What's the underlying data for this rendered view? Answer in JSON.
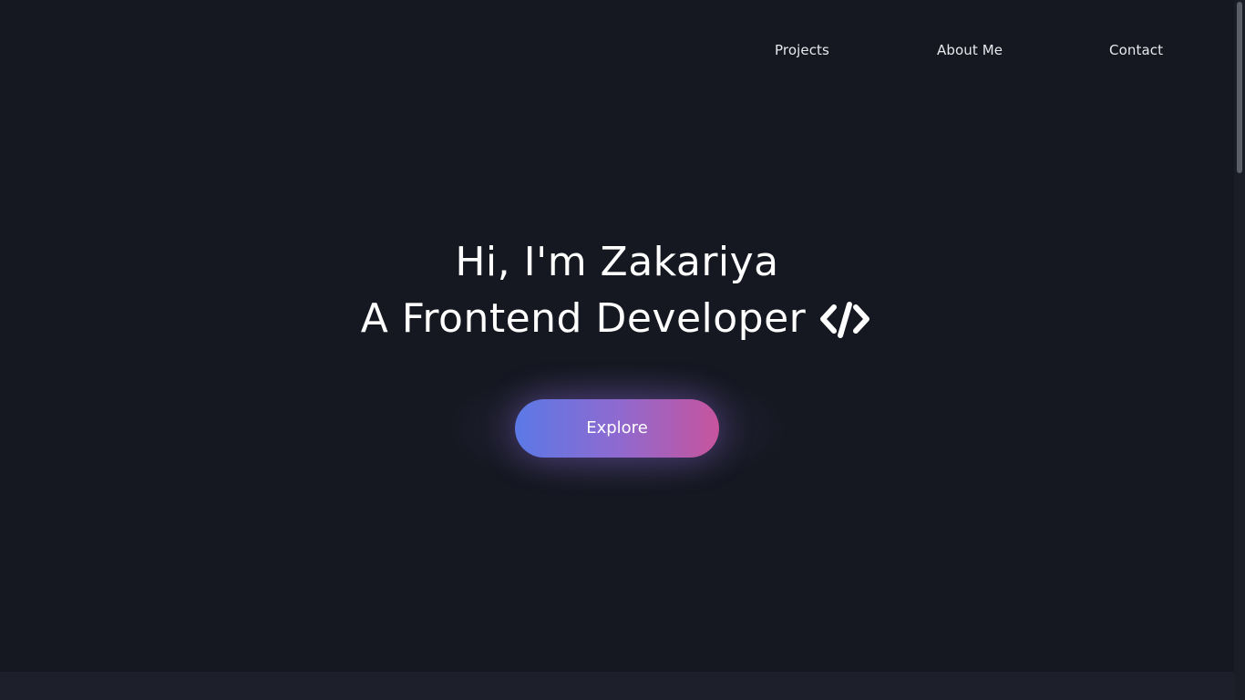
{
  "nav": {
    "links": [
      "Projects",
      "About Me",
      "Contact"
    ]
  },
  "hero": {
    "line1": "Hi, I'm Zakariya",
    "line2": "A Frontend Developer",
    "icon": "code-icon",
    "button_label": "Explore"
  },
  "colors": {
    "background": "#151821",
    "footer_strip": "#1d202b",
    "text": "#ffffff",
    "button_gradient_start": "#5b79e6",
    "button_gradient_mid": "#8e6ad0",
    "button_gradient_end": "#c7549d"
  }
}
